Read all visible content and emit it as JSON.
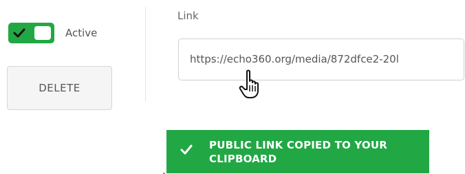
{
  "left_panel": {
    "toggle": {
      "state": "on",
      "label": "Active",
      "icon": "check-icon",
      "color": "#21a845"
    },
    "delete_button_label": "DELETE"
  },
  "link_section": {
    "label": "Link",
    "value": "https://echo360.org/media/872dfce2-20l"
  },
  "toast": {
    "message": "PUBLIC LINK COPIED TO YOUR CLIPBOARD",
    "icon": "check-icon",
    "color": "#21a845"
  },
  "cursor": {
    "type": "hand-pointer-icon"
  }
}
